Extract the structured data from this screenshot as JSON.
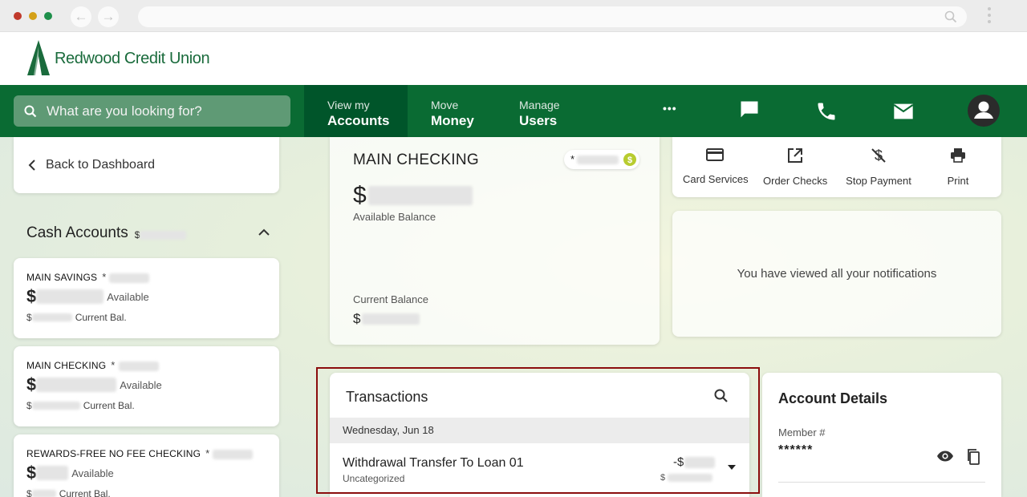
{
  "browser": {
    "traffic_lights": [
      "#c0392b",
      "#d4a017",
      "#1e8f4a"
    ],
    "back_glyph": "←",
    "forward_glyph": "→"
  },
  "brand": {
    "name": "Redwood Credit Union",
    "color": "#1a6b3c"
  },
  "nav": {
    "search_placeholder": "What are you looking for?",
    "items": [
      {
        "small": "View my",
        "big": "Accounts",
        "active": true
      },
      {
        "small": "Move",
        "big": "Money",
        "active": false
      },
      {
        "small": "Manage",
        "big": "Users",
        "active": false
      }
    ],
    "more_label": "•••",
    "icons": [
      "more-icon",
      "chat-icon",
      "phone-icon",
      "mail-icon",
      "user-icon"
    ]
  },
  "sidebar": {
    "back_label": "Back to Dashboard",
    "section_title": "Cash Accounts",
    "section_prefix": "$",
    "accounts": [
      {
        "name": "MAIN SAVINGS",
        "star": "*",
        "dollar": "$",
        "available": "Available",
        "cur_dollar": "$",
        "current": "Current Bal."
      },
      {
        "name": "MAIN CHECKING",
        "star": "*",
        "dollar": "$",
        "available": "Available",
        "cur_dollar": "$",
        "current": "Current Bal."
      },
      {
        "name": "REWARDS-FREE NO FEE CHECKING",
        "star": "*",
        "dollar": "$",
        "available": "Available",
        "cur_dollar": "$",
        "current": "Current Bal."
      }
    ]
  },
  "main_account": {
    "title": "MAIN CHECKING",
    "pill_star": "*",
    "dollar": "$",
    "available_label": "Available Balance",
    "current_label": "Current Balance",
    "current_dollar": "$"
  },
  "actions": [
    {
      "label": "Card Services",
      "icon": "card-icon"
    },
    {
      "label": "Order Checks",
      "icon": "external-link-icon"
    },
    {
      "label": "Stop Payment",
      "icon": "no-dollar-icon"
    },
    {
      "label": "Print",
      "icon": "print-icon"
    }
  ],
  "notifications": {
    "message": "You have viewed all your notifications"
  },
  "transactions": {
    "title": "Transactions",
    "day": "Wednesday, Jun 18",
    "rows": [
      {
        "description": "Withdrawal Transfer To Loan 01",
        "category": "Uncategorized",
        "amount_prefix": "-$",
        "current_prefix": "$"
      }
    ]
  },
  "details": {
    "title": "Account Details",
    "member_label": "Member #",
    "member_value": "******"
  },
  "colors": {
    "nav_green": "#0a6b33",
    "nav_active": "#00552a",
    "highlight": "#8b0d0d",
    "accent_lime": "#b8cc2f"
  }
}
